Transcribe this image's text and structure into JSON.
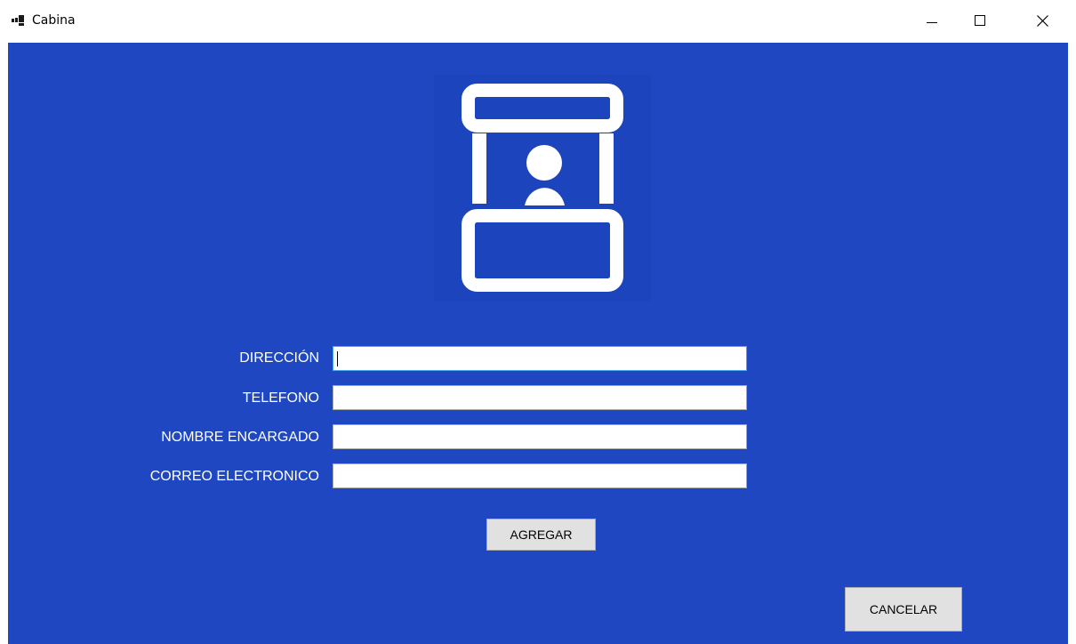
{
  "window": {
    "title": "Cabina",
    "icon": "windows-app-icon",
    "controls": [
      "minimize-icon",
      "maximize-icon",
      "close-icon"
    ]
  },
  "colors": {
    "background": "#1e47c1",
    "icon_panel": "#1c44bd",
    "icon_stroke": "#ffffff",
    "label_text": "#ffffff",
    "button_face": "#e1e1e1"
  },
  "illustration": {
    "icon": "ticket-booth-person-icon"
  },
  "form": {
    "fields": [
      {
        "label": "DIRECCIÓN",
        "value": "",
        "focused": true
      },
      {
        "label": "TELEFONO",
        "value": "",
        "focused": false
      },
      {
        "label": "NOMBRE ENCARGADO",
        "value": "",
        "focused": false
      },
      {
        "label": "CORREO ELECTRONICO",
        "value": "",
        "focused": false
      }
    ],
    "submit_label": "AGREGAR"
  },
  "cancel_label": "CANCELAR"
}
